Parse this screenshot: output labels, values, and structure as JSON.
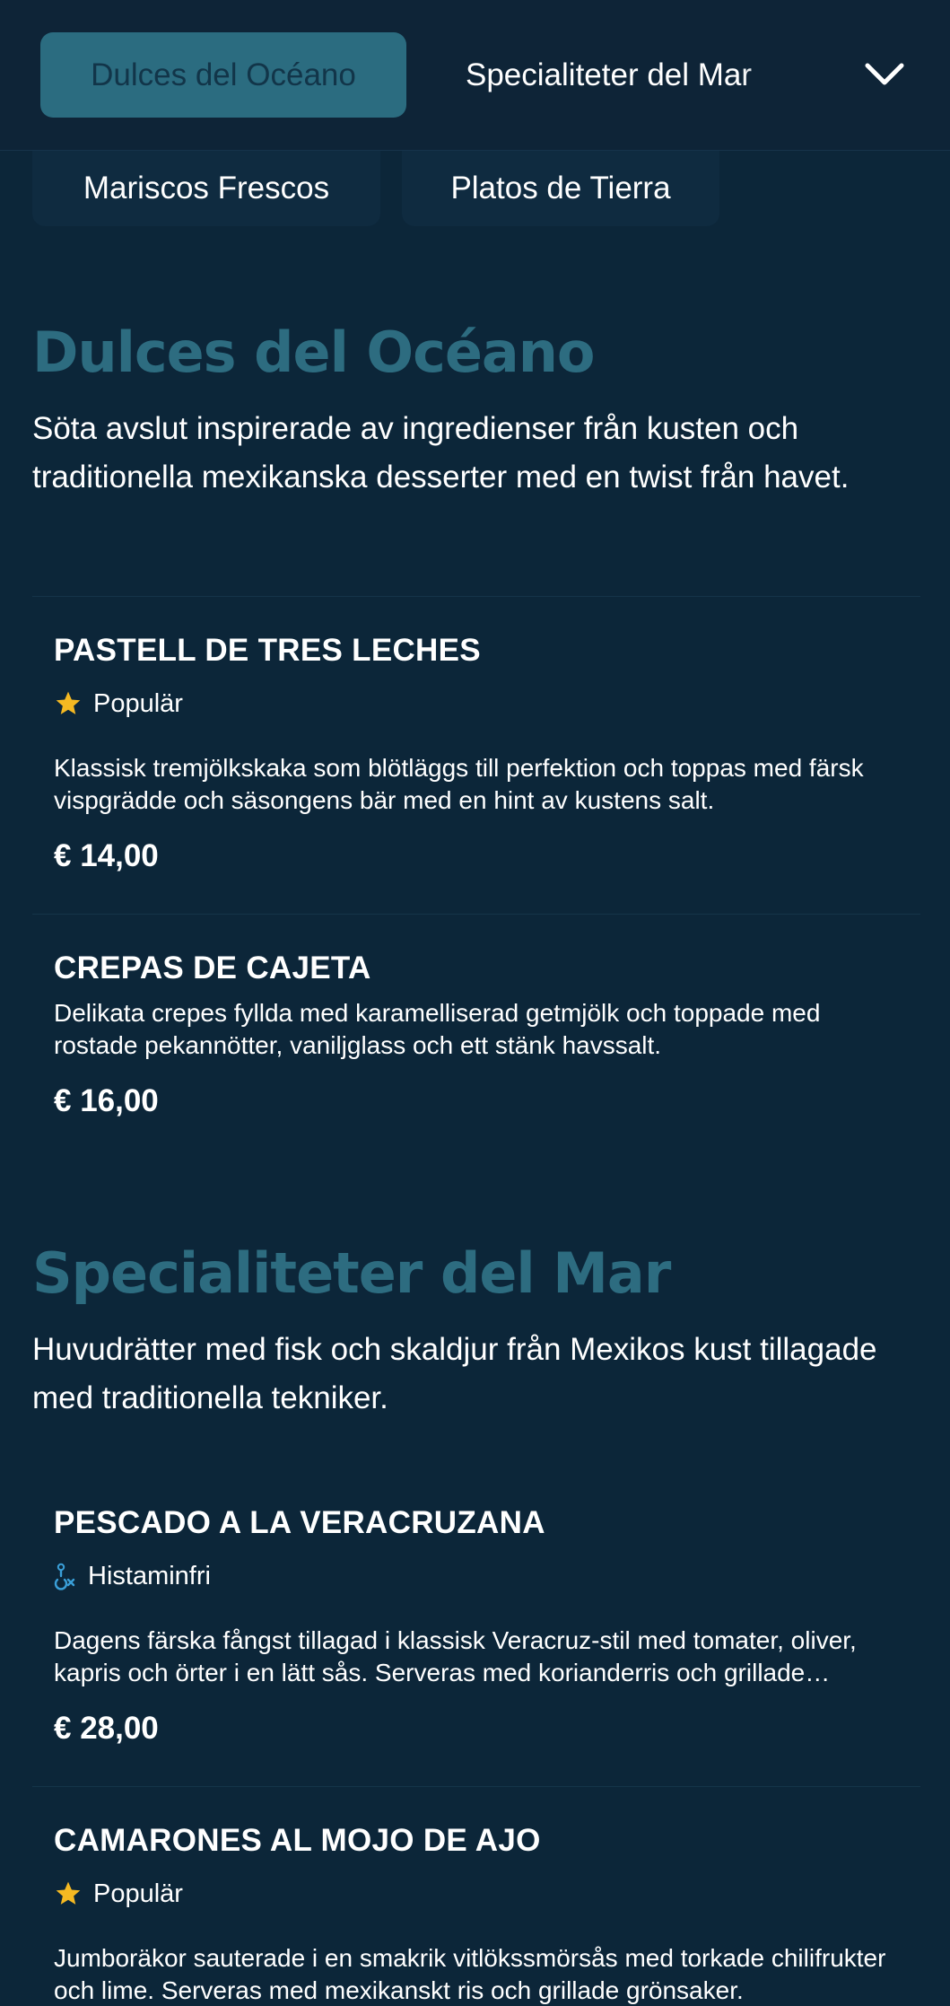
{
  "category_bar": {
    "active_tab": "Dulces del Océano",
    "next_tab": "Specialiteter del Mar",
    "row2_tabs": [
      "Mariscos Frescos",
      "Platos de Tierra"
    ]
  },
  "sections": [
    {
      "title": "Dulces del Océano",
      "description": "Söta avslut inspirerade av ingredienser från kusten och traditionella mexikanska desserter med en twist från havet.",
      "items": [
        {
          "name": "PASTELL DE TRES LECHES",
          "badge": "Populär",
          "badge_icon": "star-icon",
          "description": "Klassisk tremjölkskaka som blötläggs till perfektion och toppas med färsk vispgrädde och säsongens bär med en hint av kustens salt.",
          "price": "€ 14,00"
        },
        {
          "name": "CREPAS DE CAJETA",
          "description": "Delikata crepes fyllda med karamelliserad getmjölk och toppade med rostade pekannötter, vaniljglass och ett stänk havssalt.",
          "price": "€ 16,00"
        }
      ]
    },
    {
      "title": "Specialiteter del Mar",
      "description": "Huvudrätter med fisk och skaldjur från Mexikos kust tillagade med traditionella tekniker.",
      "items": [
        {
          "name": "PESCADO A LA VERACRUZANA",
          "badge": "Histaminfri",
          "badge_icon": "histamine-free-icon",
          "description": "Dagens färska fångst tillagad i klassisk Veracruz-stil med tomater, oliver, kapris och örter i en lätt sås. Serveras med korianderris och grillade grönsaker.",
          "price": "€ 28,00"
        },
        {
          "name": "CAMARONES AL MOJO DE AJO",
          "badge": "Populär",
          "badge_icon": "star-icon",
          "description": "Jumboräkor sauterade i en smakrik vitlökssmörsås med torkade chilifrukter och lime. Serveras med mexikanskt ris och grillade grönsaker.",
          "price": ""
        }
      ]
    }
  ],
  "colors": {
    "background": "#0c2639",
    "accent": "#2d6c80",
    "star": "#f5b922",
    "histamine_icon": "#3a9fd8"
  }
}
